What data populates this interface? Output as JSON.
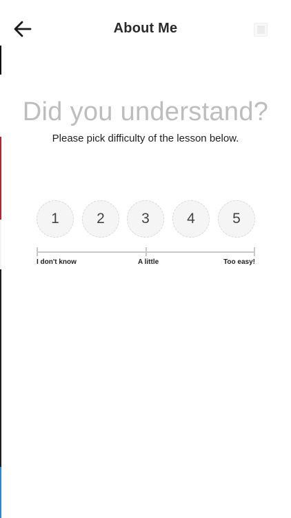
{
  "header": {
    "title": "About Me",
    "back_icon": "arrow-left-icon",
    "right_icon": "book-icon"
  },
  "prompt": {
    "headline": "Did you understand?",
    "subline": "Please pick difficulty of the lesson below."
  },
  "rating": {
    "options": [
      "1",
      "2",
      "3",
      "4",
      "5"
    ]
  },
  "scale": {
    "labels": [
      "I don't know",
      "A little",
      "Too easy!"
    ]
  },
  "colors": {
    "headline": "#bdbdbd",
    "circle_fill": "#f5f5f5",
    "circle_border": "#d8d8d8",
    "scale_line": "#c8c8c8"
  }
}
